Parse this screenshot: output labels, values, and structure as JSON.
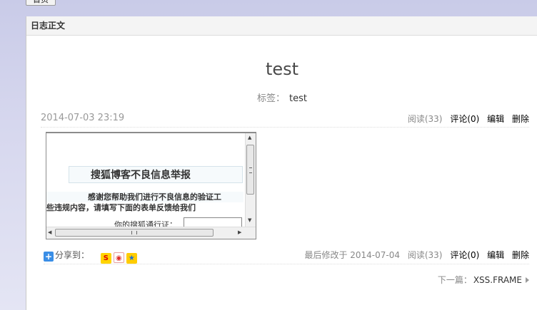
{
  "top_button": "首页",
  "panel": {
    "header": "日志正文",
    "post_title": "test",
    "tags_label": "标签：",
    "tags_value": "test",
    "date": "2014-07-03 23:19",
    "actions": {
      "read": "阅读(33)",
      "comment": "评论(0)",
      "edit": "编辑",
      "delete": "删除"
    },
    "embedded_frame": {
      "title": "搜狐博客不良信息举报",
      "text_line1": "感谢您帮助我们进行不良信息的验证工",
      "text_line2": "些违规内容，请填写下面的表单反馈给我们",
      "field_label": "你的搜狐通行证："
    },
    "footer": {
      "share_label": "分享到：",
      "share_icons": [
        "sohu-icon",
        "weibo-icon",
        "qzone-icon"
      ],
      "modified": "最后修改于 2014-07-04",
      "read": "阅读(33)",
      "comment": "评论(0)",
      "edit": "编辑",
      "delete": "删除"
    },
    "next": {
      "label": "下一篇：",
      "title": "XSS.FRAME"
    }
  },
  "colors": {
    "background": "#d6d7ee",
    "accent": "#3a8ee6"
  }
}
